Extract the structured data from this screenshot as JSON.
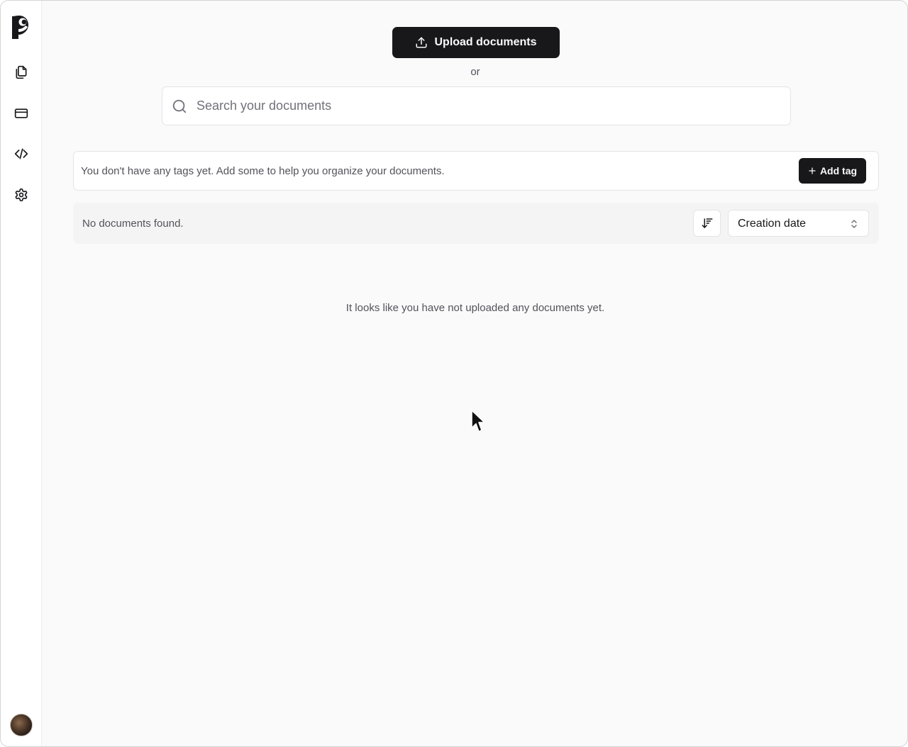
{
  "sidebar": {
    "items": [
      {
        "name": "documents",
        "icon": "files-icon"
      },
      {
        "name": "billing",
        "icon": "credit-card-icon"
      },
      {
        "name": "api",
        "icon": "code-icon"
      },
      {
        "name": "settings",
        "icon": "gear-icon"
      }
    ]
  },
  "upload": {
    "label": "Upload documents"
  },
  "or_text": "or",
  "search": {
    "placeholder": "Search your documents",
    "value": ""
  },
  "tags": {
    "message": "You don't have any tags yet. Add some to help you organize your documents.",
    "add_label": "Add tag"
  },
  "documents": {
    "status": "No documents found.",
    "sort_field": "Creation date",
    "empty_message": "It looks like you have not uploaded any documents yet."
  },
  "colors": {
    "accent": "#18181b",
    "background": "#fafafa",
    "muted_text": "#52525b"
  }
}
